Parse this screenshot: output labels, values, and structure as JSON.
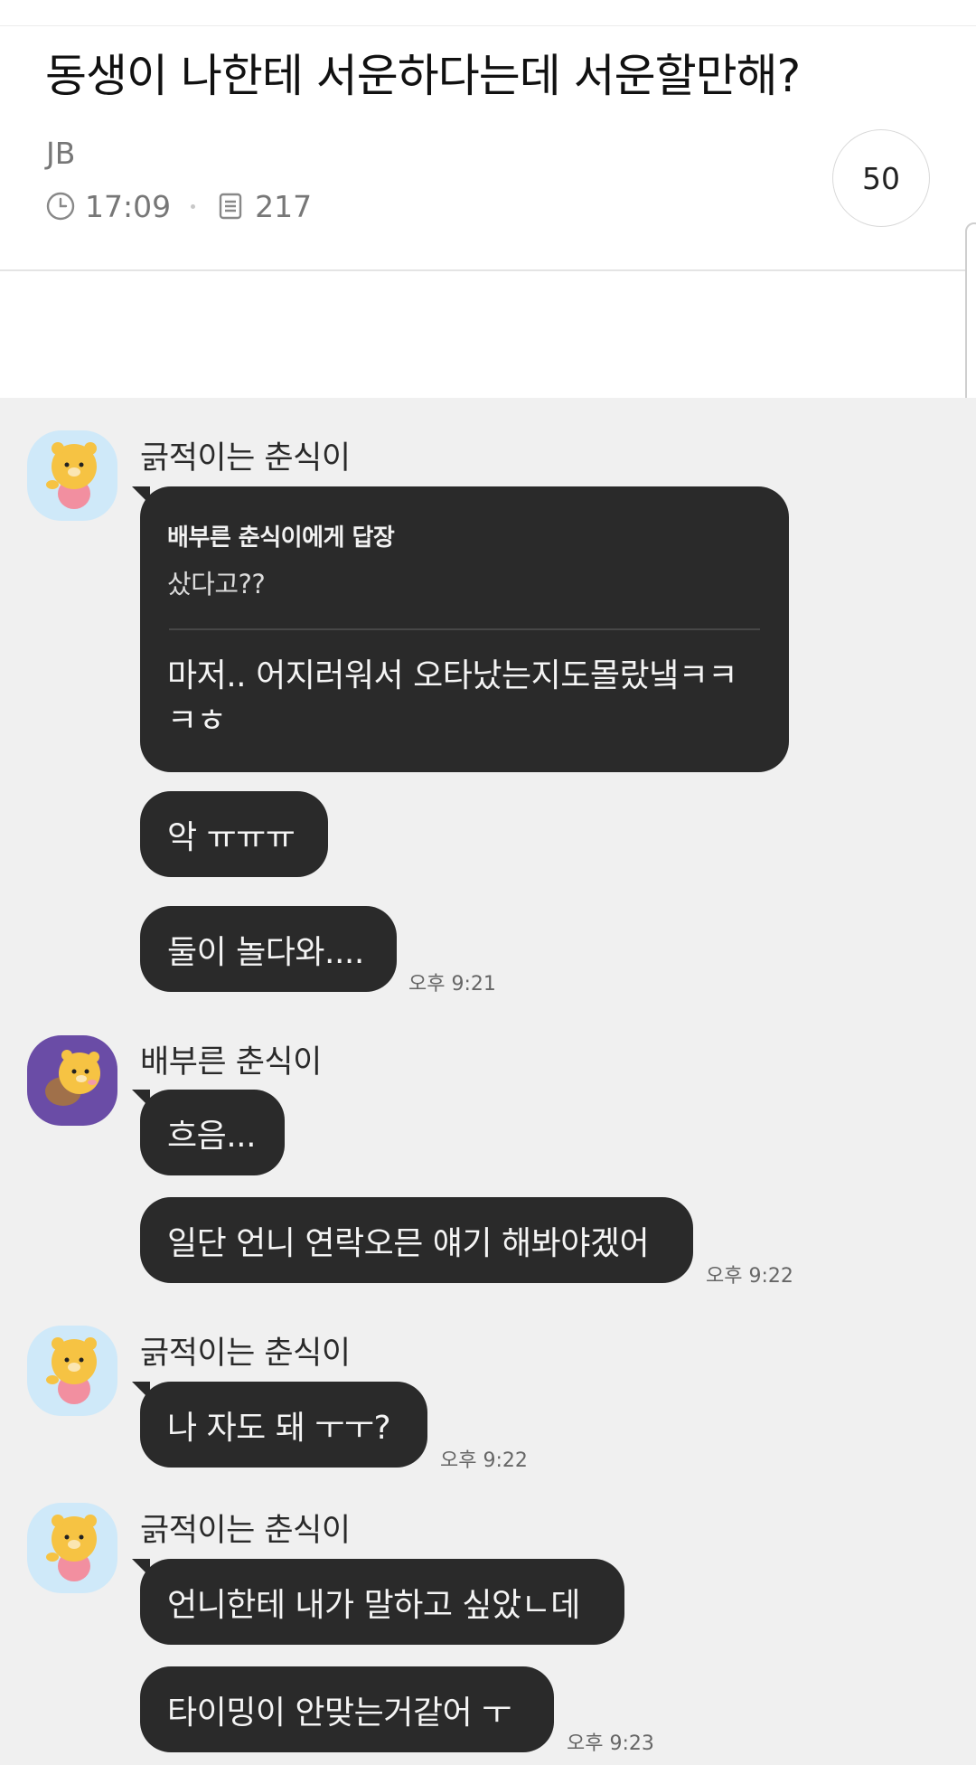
{
  "post": {
    "title": "동생이 나한테 서운하다는데 서운할만해?",
    "author": "JB",
    "time": "17:09",
    "views": "217",
    "comment_count": "50"
  },
  "chat": {
    "sender_a": "긁적이는 춘식이",
    "sender_b": "배부른 춘식이",
    "reply": {
      "label": "배부른 춘식이에게 답장",
      "quoted": "샀다고??",
      "text": "마저.. 어지러워서 오타났는지도몰랐냌ㅋㅋㅋㅎ"
    },
    "messages": {
      "m1": "악 ㅠㅠㅠ",
      "m2": "둘이 놀다와....",
      "m3": "흐음...",
      "m4": "일단 언니 연락오믄 얘기 해봐야겠어",
      "m5": "나 자도 돼 ㅜㅜ?",
      "m6": "언니한테 내가 말하고 싶았ㄴ데",
      "m7": "타이밍이 안맞는거같어 ㅜ"
    },
    "times": {
      "t1": "오후 9:21",
      "t2": "오후 9:22",
      "t3": "오후 9:22",
      "t4": "오후 9:23"
    }
  },
  "icons": {
    "clock": "clock-icon",
    "views": "document-icon",
    "avatar_a": "yellow-cat-character",
    "avatar_b": "yellow-cat-character-purple"
  },
  "colors": {
    "bubble": "#2a2a2a",
    "chat_bg": "#f0f0f0",
    "avatar_a_bg": "#cfe9f9",
    "avatar_b_bg": "#6a4ca6"
  }
}
